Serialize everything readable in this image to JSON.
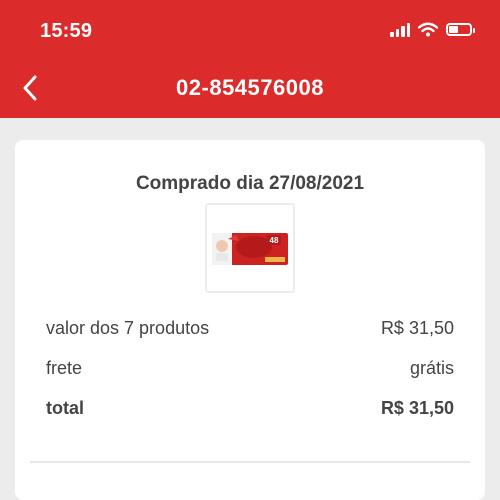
{
  "status_bar": {
    "time": "15:59"
  },
  "header": {
    "title": "02-854576008",
    "back_icon": "chevron-left-icon",
    "color": "#db2b2b"
  },
  "order": {
    "purchase_date_label": "Comprado dia 27/08/2021",
    "product_image_badge": "48",
    "summary": [
      {
        "label": "valor dos 7 produtos",
        "value": "R$ 31,50"
      },
      {
        "label": "frete",
        "value": "grátis"
      },
      {
        "label": "total",
        "value": "R$ 31,50"
      }
    ]
  }
}
